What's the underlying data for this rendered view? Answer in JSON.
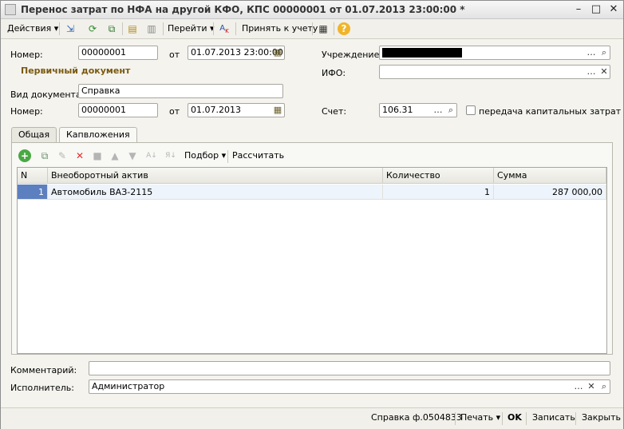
{
  "window": {
    "title": "Перенос затрат по НФА на другой КФО, КПС 00000001 от 01.07.2013 23:00:00 *",
    "controls": [
      "–",
      "□",
      "✕"
    ]
  },
  "toolbar": {
    "actions_label": "Действия",
    "goto_label": "Перейти",
    "accept_label": "Принять к учету"
  },
  "header": {
    "number_label": "Номер:",
    "number_value": "00000001",
    "from_label": "от",
    "date_value": "01.07.2013 23:00:00",
    "primary_doc_label": "Первичный документ",
    "doc_type_label": "Вид документа:",
    "doc_type_value": "Справка",
    "number2_label": "Номер:",
    "number2_value": "00000001",
    "from2_label": "от",
    "date2_value": "01.07.2013",
    "institution_label": "Учреждение:",
    "ifo_label": "ИФО:",
    "account_label": "Счет:",
    "account_value": "106.31",
    "capital_transfer_label": "передача капитальных затрат"
  },
  "tabs": [
    {
      "label": "Общая"
    },
    {
      "label": "Капвложения"
    }
  ],
  "panel_toolbar": {
    "selection_label": "Подбор",
    "calculate_label": "Рассчитать"
  },
  "table": {
    "columns": [
      "N",
      "Внеоборотный актив",
      "Количество",
      "Сумма"
    ],
    "rows": [
      {
        "n": "1",
        "asset": "Автомобиль ВАЗ-2115",
        "qty": "1",
        "sum": "287 000,00"
      }
    ]
  },
  "footer": {
    "comment_label": "Комментарий:",
    "comment_value": "",
    "executor_label": "Исполнитель:",
    "executor_value": "Администратор"
  },
  "statusbar": {
    "print_form_label": "Справка ф.0504833",
    "print_label": "Печать",
    "ok_label": "OK",
    "save_label": "Записать",
    "close_label": "Закрыть"
  }
}
